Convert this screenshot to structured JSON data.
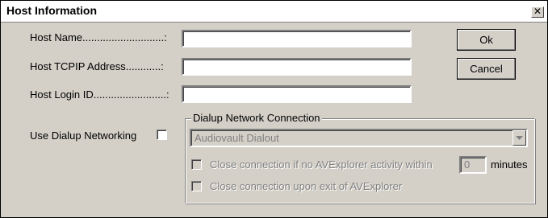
{
  "dialog": {
    "title": "Host Information",
    "close_glyph": "✕"
  },
  "fields": {
    "host_name_label": "Host Name............................:",
    "host_name_value": "",
    "tcpip_label": "Host TCPIP Address............:",
    "tcpip_value": "",
    "login_label": "Host Login ID.........................:",
    "login_value": ""
  },
  "buttons": {
    "ok_label": "Ok",
    "cancel_label": "Cancel"
  },
  "dialup": {
    "use_label": "Use Dialup Networking",
    "use_checked": false,
    "group_title": "Dialup Network Connection",
    "connection_selected": "Audiovault Dialout",
    "close_inactivity_label": "Close connection if no AVExplorer activity within",
    "inactivity_minutes": "0",
    "minutes_label": "minutes",
    "close_on_exit_label": "Close connection upon exit of AVExplorer"
  },
  "icons": {
    "close": "close-icon",
    "dropdown": "chevron-down-icon"
  }
}
